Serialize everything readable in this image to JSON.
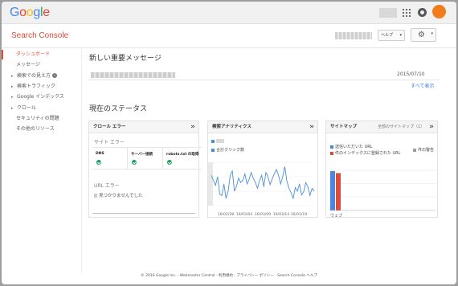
{
  "google_logo": [
    "G",
    "o",
    "o",
    "g",
    "l",
    "e"
  ],
  "google_logo_colors": [
    "#4285f4",
    "#ea4335",
    "#fbbc05",
    "#4285f4",
    "#34a853",
    "#ea4335"
  ],
  "topbar": {
    "accent_avatar_color": "#f07c1c",
    "icons": [
      "apps-grid-icon",
      "notifications-icon",
      "avatar"
    ]
  },
  "header": {
    "brand": "Search Console",
    "help_label": "ヘルプ",
    "help_caret": "▾",
    "gear_icon": "⚙",
    "gear_caret": "▾"
  },
  "sidebar": {
    "items": [
      {
        "label": "ダッシュボード",
        "active": true
      },
      {
        "label": "メッセージ"
      },
      {
        "label": "検索での見え方",
        "expand": true,
        "info": "i"
      },
      {
        "label": "検索トラフィック",
        "expand": true
      },
      {
        "label": "Google インデックス",
        "expand": true
      },
      {
        "label": "クロール",
        "expand": true
      },
      {
        "label": "セキュリティの問題"
      },
      {
        "label": "その他のリソース"
      }
    ]
  },
  "messages": {
    "title": "新しい重要メッセージ",
    "date": "2015/07/10",
    "show_all": "すべて表示"
  },
  "status": {
    "title": "現在のステータス",
    "crawl_errors": {
      "title": "クロール エラー",
      "site_errors": "サイト エラー",
      "columns": [
        "DNS",
        "サーバー接続",
        "robots.txt の取得"
      ],
      "url_errors": "URL エラー",
      "none_found": "見つかりませんでした"
    },
    "search_analytics": {
      "title": "検索アナリティクス",
      "metric": "合計クリック数",
      "series_color": "#4a90d9"
    },
    "sitemaps": {
      "title": "サイトマップ",
      "all_link": "全部のサイトマップ（1）",
      "legend": [
        "送信いただいた URL",
        "件のインデックスに登録された URL",
        "件の警告"
      ],
      "legend_colors": [
        "#4a86e8",
        "#dd4b39",
        "#9e9e9e"
      ],
      "web_label": "ウェブ"
    }
  },
  "chart_data": {
    "type": "line",
    "x": [
      "16/02/28",
      "16/03/04",
      "16/03/09",
      "16/03/14",
      "16/03/19"
    ],
    "series": [
      {
        "name": "合計クリック数",
        "values": [
          62,
          55,
          48,
          60,
          36,
          34,
          50,
          30,
          40,
          62,
          68,
          40,
          47,
          58,
          52,
          55,
          64,
          50,
          56,
          66,
          58,
          52,
          44,
          55,
          62,
          46,
          66,
          60,
          49,
          57,
          64,
          70,
          62,
          50,
          60,
          74,
          54,
          44,
          38,
          30,
          45,
          40,
          50,
          35,
          39,
          52,
          46,
          34,
          44,
          40
        ]
      }
    ],
    "grid": true,
    "xlabel": "",
    "ylabel": "",
    "sitemap_bars": {
      "categories": [
        "ウェブ"
      ],
      "series": [
        {
          "name": "送信いただいた URL",
          "values": [
            1
          ]
        },
        {
          "name": "件のインデックスに登録された URL",
          "values": [
            0.95
          ]
        }
      ]
    }
  },
  "footer": "© 2016 Google Inc. - Webmaster Central - 利用規約 - プライバシー ポリシー - Search Console ヘルプ"
}
